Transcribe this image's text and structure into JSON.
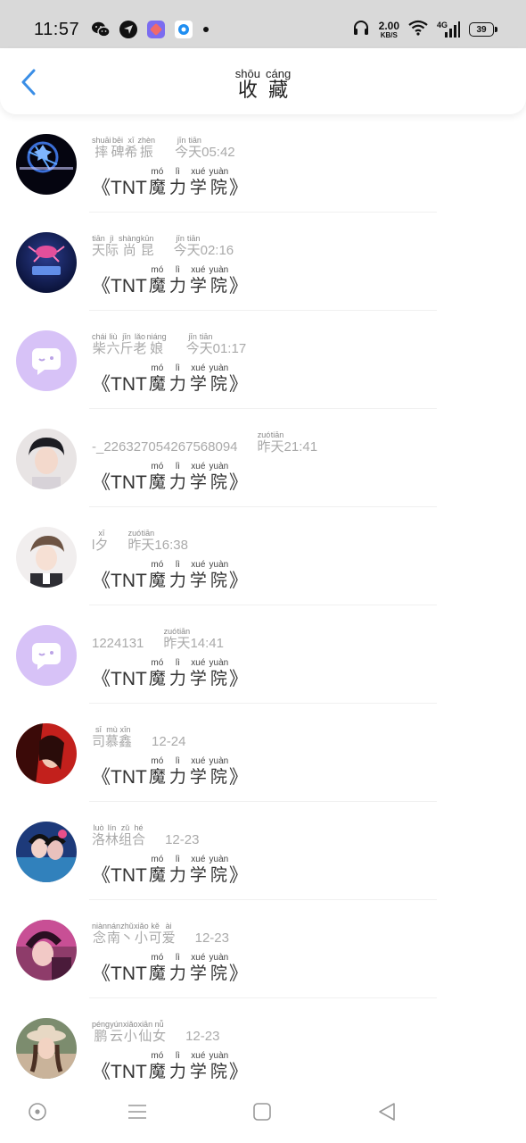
{
  "status_bar": {
    "time": "11:57",
    "app_icons": [
      "wechat-icon",
      "app-icon-1",
      "app-icon-2",
      "app-icon-3"
    ],
    "net_speed": "2.00",
    "net_unit": "KB/S",
    "network": "4G",
    "battery": "39"
  },
  "header": {
    "title": [
      {
        "py": "shōu",
        "hz": "收"
      },
      {
        "py": "cáng",
        "hz": "藏"
      }
    ]
  },
  "colors": {
    "accent": "#3a8ee6",
    "placeholder_avatar": "#d7c2f7",
    "status_bar_bg": "#d9d9d9"
  },
  "message_prefix": "《TNT",
  "message_suffix": "》",
  "message": [
    {
      "py": "mó",
      "hz": "魔"
    },
    {
      "py": "lì",
      "hz": "力"
    },
    {
      "py": "xué",
      "hz": "学"
    },
    {
      "py": "yuàn",
      "hz": "院"
    }
  ],
  "favorites": [
    {
      "avatar": "galaxy-avatar",
      "name_plain": "",
      "name": [
        {
          "py": "shuāi",
          "hz": "摔"
        },
        {
          "py": "bēi",
          "hz": "碑"
        },
        {
          "py": "xī",
          "hz": "希"
        },
        {
          "py": "zhèn",
          "hz": "振"
        }
      ],
      "day": [
        {
          "py": "jīn",
          "hz": "今"
        },
        {
          "py": "tiān",
          "hz": "天"
        }
      ],
      "time": "05:42"
    },
    {
      "avatar": "constellation-avatar",
      "name_plain": "",
      "name": [
        {
          "py": "tiān",
          "hz": "天"
        },
        {
          "py": "jì",
          "hz": "际"
        },
        {
          "py": "shàng",
          "hz": "尚"
        },
        {
          "py": "kūn",
          "hz": "昆"
        }
      ],
      "day": [
        {
          "py": "jīn",
          "hz": "今"
        },
        {
          "py": "tiān",
          "hz": "天"
        }
      ],
      "time": "02:16"
    },
    {
      "avatar": "default-avatar",
      "name_plain": "",
      "name": [
        {
          "py": "chái",
          "hz": "柴"
        },
        {
          "py": "liù",
          "hz": "六"
        },
        {
          "py": "jīn",
          "hz": "斤"
        },
        {
          "py": "lǎo",
          "hz": "老"
        },
        {
          "py": "niáng",
          "hz": "娘"
        }
      ],
      "day": [
        {
          "py": "jīn",
          "hz": "今"
        },
        {
          "py": "tiān",
          "hz": "天"
        }
      ],
      "time": "01:17"
    },
    {
      "avatar": "boy-portrait-avatar",
      "name_plain": "-_226327054267568094",
      "name": [],
      "day": [
        {
          "py": "zuó",
          "hz": "昨"
        },
        {
          "py": "tiān",
          "hz": "天"
        }
      ],
      "time": "21:41"
    },
    {
      "avatar": "boy-portrait-avatar-2",
      "name_plain": "l",
      "name": [
        {
          "py": "xī",
          "hz": "夕"
        }
      ],
      "day": [
        {
          "py": "zuó",
          "hz": "昨"
        },
        {
          "py": "tiān",
          "hz": "天"
        }
      ],
      "time": "16:38"
    },
    {
      "avatar": "default-avatar",
      "name_plain": "1224131",
      "name": [],
      "day": [
        {
          "py": "zuó",
          "hz": "昨"
        },
        {
          "py": "tiān",
          "hz": "天"
        }
      ],
      "time": "14:41"
    },
    {
      "avatar": "red-art-avatar",
      "name_plain": "",
      "name": [
        {
          "py": "sī",
          "hz": "司"
        },
        {
          "py": "mù",
          "hz": "慕"
        },
        {
          "py": "xīn",
          "hz": "鑫"
        }
      ],
      "day": [],
      "time": "12-24"
    },
    {
      "avatar": "group-art-avatar",
      "name_plain": "",
      "name": [
        {
          "py": "luò",
          "hz": "洛"
        },
        {
          "py": "lín",
          "hz": "林"
        },
        {
          "py": "zǔ",
          "hz": "组"
        },
        {
          "py": "hé",
          "hz": "合"
        }
      ],
      "day": [],
      "time": "12-23"
    },
    {
      "avatar": "pink-art-avatar",
      "name_plain": "",
      "name": [
        {
          "py": "niàn",
          "hz": "念"
        },
        {
          "py": "nán",
          "hz": "南"
        },
        {
          "py": "zhǔ",
          "hz": "丶"
        },
        {
          "py": "xiǎo",
          "hz": "小"
        },
        {
          "py": "kě",
          "hz": "可"
        },
        {
          "py": "ài",
          "hz": "爱"
        }
      ],
      "day": [],
      "time": "12-23"
    },
    {
      "avatar": "girl-hat-avatar",
      "name_plain": "",
      "name": [
        {
          "py": "péng",
          "hz": "鹏"
        },
        {
          "py": "yún",
          "hz": "云"
        },
        {
          "py": "xiǎo",
          "hz": "小"
        },
        {
          "py": "xiān",
          "hz": "仙"
        },
        {
          "py": "nǚ",
          "hz": "女"
        }
      ],
      "day": [],
      "time": "12-23"
    }
  ],
  "nav": [
    "home-circle-icon",
    "menu-icon",
    "square-icon",
    "back-triangle-icon"
  ]
}
